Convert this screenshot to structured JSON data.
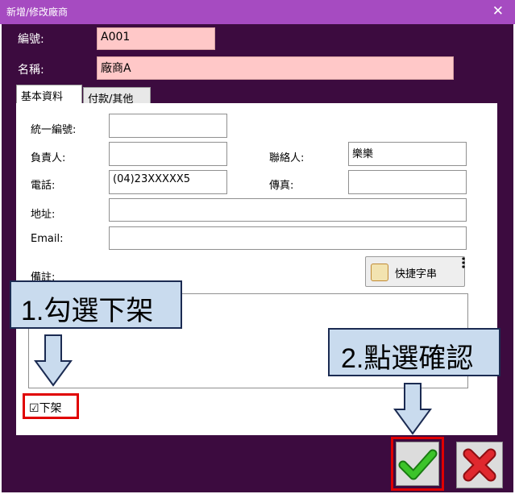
{
  "window": {
    "title": "新增/修改廠商",
    "close_glyph": "✕"
  },
  "header": {
    "code_label": "編號:",
    "code_value": "A001",
    "name_label": "名稱:",
    "name_value": "廠商A"
  },
  "tabs": [
    {
      "label": "基本資料",
      "active": true
    },
    {
      "label": "付款/其他",
      "active": false
    }
  ],
  "form": {
    "tax_id_label": "統一編號:",
    "tax_id_value": "",
    "owner_label": "負責人:",
    "owner_value": "",
    "contact_label": "聯絡人:",
    "contact_value": "樂樂",
    "phone_label": "電話:",
    "phone_value": "(04)23XXXXX5",
    "fax_label": "傳真:",
    "fax_value": "",
    "address_label": "地址:",
    "address_value": "",
    "email_label": "Email:",
    "email_value": "",
    "notes_label": "備註:",
    "notes_value": "",
    "quick_phrase_button": "快捷字串",
    "delist_checkbox_glyph": "☑",
    "delist_label": "下架",
    "delist_checked": true
  },
  "annotations": {
    "step1": "1.勾選下架",
    "step2": "2.點選確認"
  },
  "actions": {
    "confirm_icon": "check-icon",
    "cancel_icon": "x-icon"
  },
  "colors": {
    "titlebar": "#a64bc1",
    "window_body": "#3c0b3f",
    "required_field": "#ffc8c8",
    "callout_fill": "#c9dbee",
    "highlight": "#e00000",
    "confirm_green": "#2fae1e",
    "cancel_red": "#d0141c"
  }
}
